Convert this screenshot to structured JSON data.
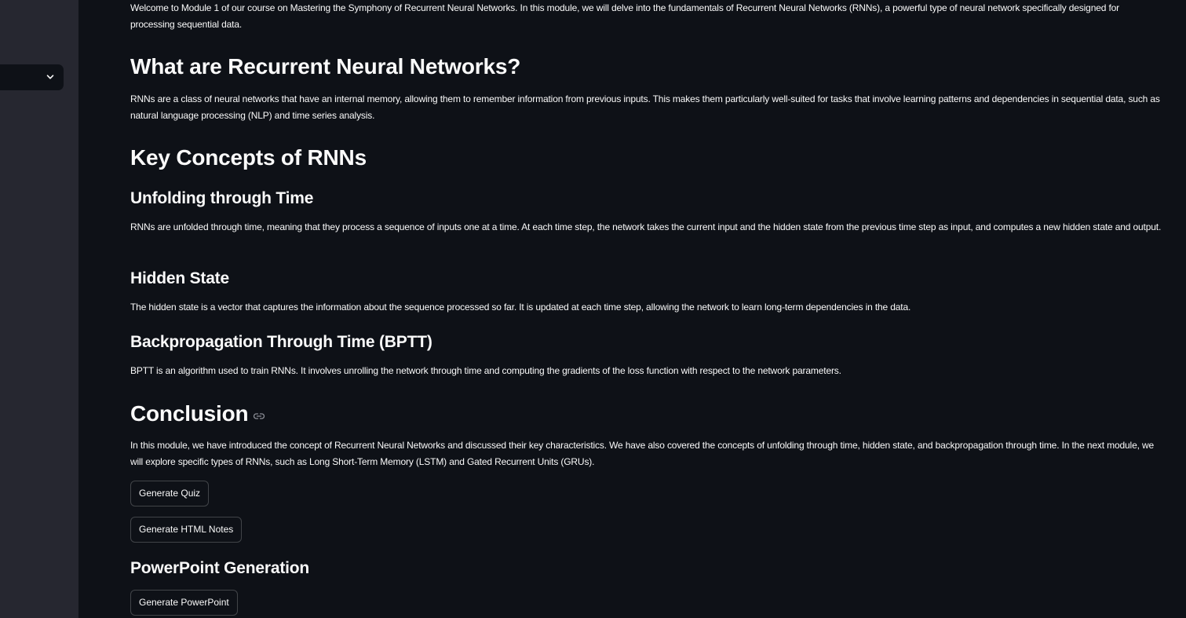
{
  "sidebar": {
    "select_icon": "chevron-down-icon"
  },
  "main": {
    "intro": "Welcome to Module 1 of our course on Mastering the Symphony of Recurrent Neural Networks. In this module, we will delve into the fundamentals of Recurrent Neural Networks (RNNs), a powerful type of neural network specifically designed for processing sequential data.",
    "what_heading": "What are Recurrent Neural Networks?",
    "what_text": "RNNs are a class of neural networks that have an internal memory, allowing them to remember information from previous inputs. This makes them particularly well-suited for tasks that involve learning patterns and dependencies in sequential data, such as natural language processing (NLP) and time series analysis.",
    "key_heading": "Key Concepts of RNNs",
    "unfolding_heading": "Unfolding through Time",
    "unfolding_text": "RNNs are unfolded through time, meaning that they process a sequence of inputs one at a time. At each time step, the network takes the current input and the hidden state from the previous time step as input, and computes a new hidden state and output.",
    "hidden_heading": "Hidden State",
    "hidden_text": "The hidden state is a vector that captures the information about the sequence processed so far. It is updated at each time step, allowing the network to learn long-term dependencies in the data.",
    "bptt_heading": "Backpropagation Through Time (BPTT)",
    "bptt_text": "BPTT is an algorithm used to train RNNs. It involves unrolling the network through time and computing the gradients of the loss function with respect to the network parameters.",
    "conclusion_heading": "Conclusion",
    "conclusion_icon": "link-icon",
    "conclusion_text": "In this module, we have introduced the concept of Recurrent Neural Networks and discussed their key characteristics. We have also covered the concepts of unfolding through time, hidden state, and backpropagation through time. In the next module, we will explore specific types of RNNs, such as Long Short-Term Memory (LSTM) and Gated Recurrent Units (GRUs).",
    "quiz_button": "Generate Quiz",
    "notes_button": "Generate HTML Notes",
    "ppt_heading": "PowerPoint Generation",
    "ppt_button": "Generate PowerPoint"
  },
  "colors": {
    "background": "#0e1117",
    "sidebar": "#262730",
    "text": "#fafafa"
  }
}
